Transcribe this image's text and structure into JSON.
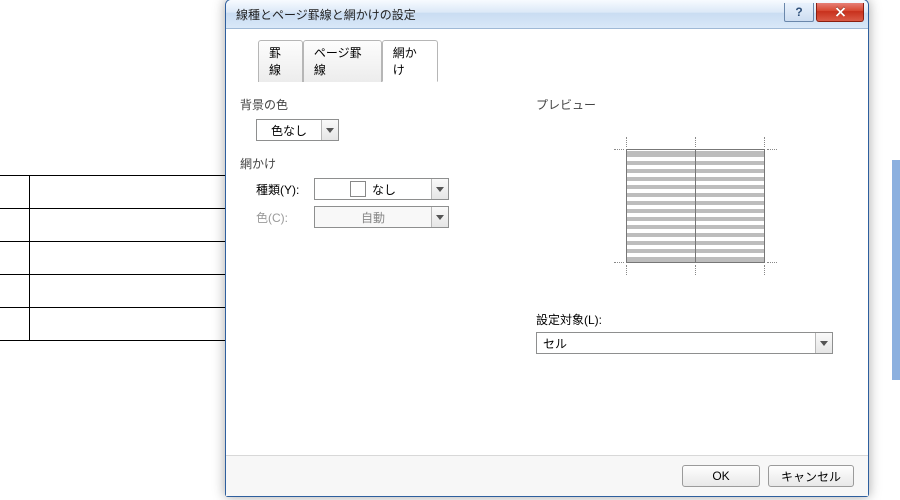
{
  "bg_table_cells": [
    "↲",
    "↲",
    "↲",
    "↲",
    "↲"
  ],
  "dialog": {
    "title": "線種とページ罫線と網かけの設定",
    "help_tooltip": "?",
    "close_tooltip": "×"
  },
  "tabs": [
    "罫線",
    "ページ罫線",
    "網かけ"
  ],
  "active_tab_index": 2,
  "bg_section_label": "背景の色",
  "bg_color_value": "色なし",
  "shading_section_label": "網かけ",
  "pattern_label": "種類(Y):",
  "pattern_value": "なし",
  "color_label": "色(C):",
  "color_value": "自動",
  "preview_label": "プレビュー",
  "apply_to_label": "設定対象(L):",
  "apply_to_value": "セル",
  "buttons": {
    "ok": "OK",
    "cancel": "キャンセル"
  }
}
